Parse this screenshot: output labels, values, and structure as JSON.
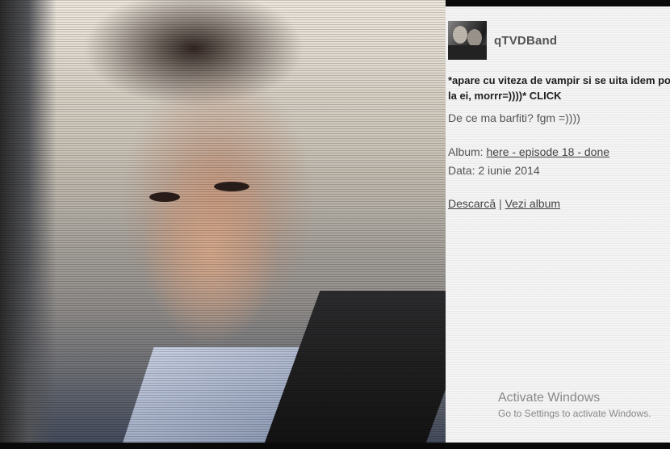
{
  "post": {
    "author": "qTVDBand",
    "caption": "*apare cu viteza de vampir si se uita idem poza la ei, morrr=))))* CLICK",
    "comment": "De ce ma barfiti? fgm =))))",
    "album_label": "Album:",
    "album_link": "here - episode 18 - done",
    "date_label": "Data:",
    "date_value": "2 iunie 2014",
    "download_link": "Descarcă",
    "separator": "|",
    "view_album_link": "Vezi album"
  },
  "watermark": {
    "title": "Activate Windows",
    "subtitle": "Go to Settings to activate Windows."
  },
  "colors": {
    "panel_bg": "#f4f4f4",
    "frame": "#0a0a0a",
    "text": "#555555"
  },
  "icons": {
    "avatar": "avatar-image"
  }
}
